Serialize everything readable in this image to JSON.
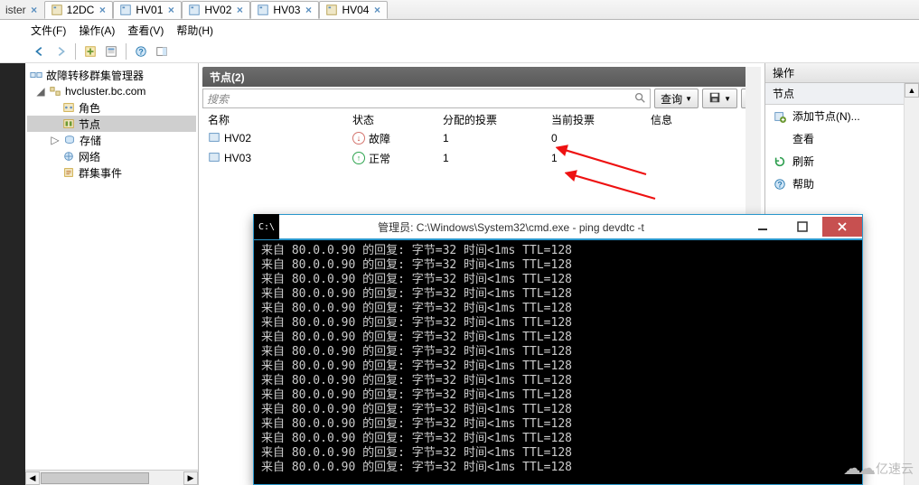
{
  "tabs": {
    "partial": "ister",
    "items": [
      {
        "label": "12DC"
      },
      {
        "label": "HV01"
      },
      {
        "label": "HV02"
      },
      {
        "label": "HV03",
        "active": true
      },
      {
        "label": "HV04"
      }
    ]
  },
  "menubar": {
    "file": "文件(F)",
    "action": "操作(A)",
    "view": "查看(V)",
    "help": "帮助(H)"
  },
  "tree": {
    "root": "故障转移群集管理器",
    "cluster": "hvcluster.bc.com",
    "roles": "角色",
    "nodes": "节点",
    "storage": "存储",
    "network": "网络",
    "events": "群集事件"
  },
  "mid": {
    "title": "节点(2)",
    "search_placeholder": "搜索",
    "query_btn": "查询",
    "columns": {
      "name": "名称",
      "state": "状态",
      "alloc": "分配的投票",
      "current": "当前投票",
      "info": "信息"
    },
    "rows": [
      {
        "name": "HV02",
        "state_label": "故障",
        "state": "fail",
        "alloc": "1",
        "current": "0",
        "info": ""
      },
      {
        "name": "HV03",
        "state_label": "正常",
        "state": "ok",
        "alloc": "1",
        "current": "1",
        "info": ""
      }
    ]
  },
  "actions": {
    "header": "操作",
    "section": "节点",
    "add": "添加节点(N)...",
    "view": "查看",
    "refresh": "刷新",
    "help": "帮助"
  },
  "console": {
    "title": "管理员: C:\\Windows\\System32\\cmd.exe - ping  devdtc -t",
    "line": "来自 80.0.0.90 的回复: 字节=32 时间<1ms TTL=128",
    "count": 16
  },
  "watermark": "亿速云"
}
